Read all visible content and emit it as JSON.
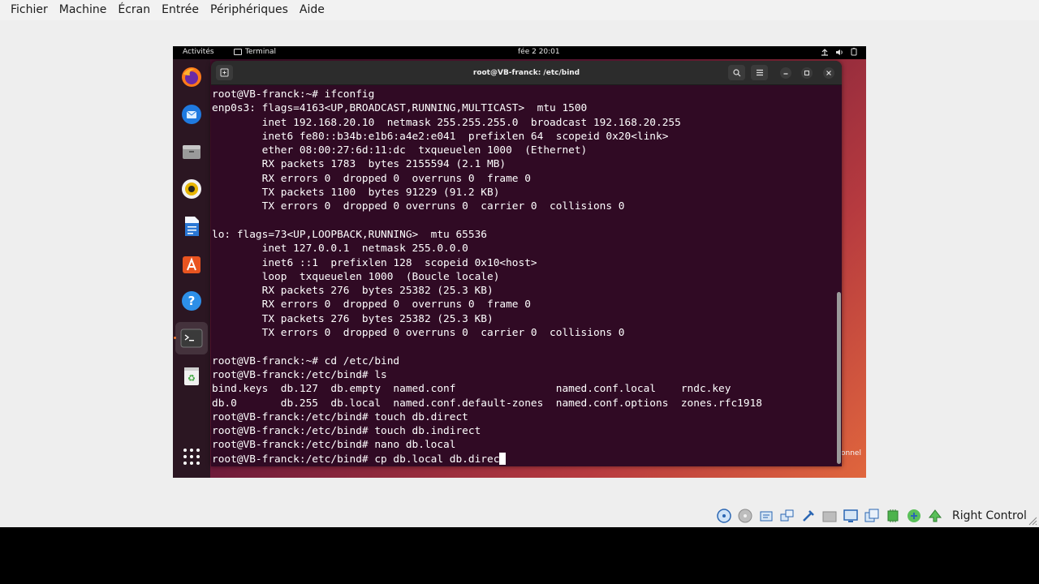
{
  "host": {
    "menu": [
      "Fichier",
      "Machine",
      "Écran",
      "Entrée",
      "Périphériques",
      "Aide"
    ],
    "host_key": "Right Control",
    "status_icons": [
      "hard-disk-icon",
      "optical-drive-icon",
      "audio-icon",
      "network-icon",
      "usb-icon",
      "shared-folder-icon",
      "display-icon",
      "video-capture-icon",
      "cpu-icon",
      "mouse-integration-icon",
      "keyboard-icon"
    ]
  },
  "guest": {
    "topbar": {
      "activities": "Activités",
      "app": "Terminal",
      "clock": "fée 2  20:01"
    },
    "background_label": "onnel",
    "dock": [
      {
        "name": "firefox-icon"
      },
      {
        "name": "thunderbird-icon"
      },
      {
        "name": "files-icon"
      },
      {
        "name": "rhythmbox-icon"
      },
      {
        "name": "writer-icon"
      },
      {
        "name": "app-center-icon"
      },
      {
        "name": "help-icon"
      },
      {
        "name": "terminal-icon"
      },
      {
        "name": "trash-icon"
      },
      {
        "name": "show-apps-icon"
      }
    ],
    "terminal": {
      "title": "root@VB-franck: /etc/bind",
      "lines": [
        "root@VB-franck:~# ifconfig",
        "enp0s3: flags=4163<UP,BROADCAST,RUNNING,MULTICAST>  mtu 1500",
        "        inet 192.168.20.10  netmask 255.255.255.0  broadcast 192.168.20.255",
        "        inet6 fe80::b34b:e1b6:a4e2:e041  prefixlen 64  scopeid 0x20<link>",
        "        ether 08:00:27:6d:11:dc  txqueuelen 1000  (Ethernet)",
        "        RX packets 1783  bytes 2155594 (2.1 MB)",
        "        RX errors 0  dropped 0  overruns 0  frame 0",
        "        TX packets 1100  bytes 91229 (91.2 KB)",
        "        TX errors 0  dropped 0 overruns 0  carrier 0  collisions 0",
        "",
        "lo: flags=73<UP,LOOPBACK,RUNNING>  mtu 65536",
        "        inet 127.0.0.1  netmask 255.0.0.0",
        "        inet6 ::1  prefixlen 128  scopeid 0x10<host>",
        "        loop  txqueuelen 1000  (Boucle locale)",
        "        RX packets 276  bytes 25382 (25.3 KB)",
        "        RX errors 0  dropped 0  overruns 0  frame 0",
        "        TX packets 276  bytes 25382 (25.3 KB)",
        "        TX errors 0  dropped 0 overruns 0  carrier 0  collisions 0",
        "",
        "root@VB-franck:~# cd /etc/bind",
        "root@VB-franck:/etc/bind# ls",
        "bind.keys  db.127  db.empty  named.conf                named.conf.local    rndc.key",
        "db.0       db.255  db.local  named.conf.default-zones  named.conf.options  zones.rfc1918",
        "root@VB-franck:/etc/bind# touch db.direct",
        "root@VB-franck:/etc/bind# touch db.indirect",
        "root@VB-franck:/etc/bind# nano db.local"
      ],
      "current_input": "root@VB-franck:/etc/bind# cp db.local db.direc"
    }
  }
}
